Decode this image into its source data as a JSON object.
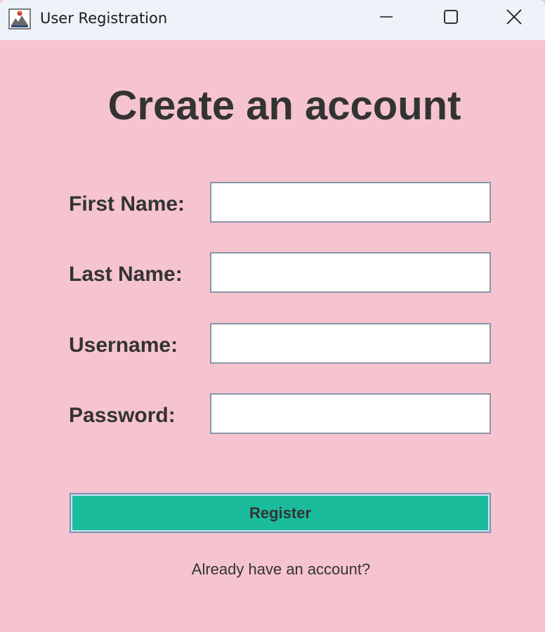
{
  "window": {
    "title": "User Registration",
    "icon": "java-app-icon",
    "controls": {
      "minimize_icon": "minimize-icon",
      "maximize_icon": "maximize-icon",
      "close_icon": "close-icon"
    }
  },
  "form": {
    "heading": "Create an account",
    "fields": [
      {
        "label": "First Name:",
        "value": "",
        "placeholder": ""
      },
      {
        "label": "Last Name:",
        "value": "",
        "placeholder": ""
      },
      {
        "label": "Username:",
        "value": "",
        "placeholder": ""
      },
      {
        "label": "Password:",
        "value": "",
        "placeholder": ""
      }
    ],
    "register_label": "Register",
    "login_link": "Already have an account?"
  },
  "colors": {
    "background": "#f5c4cf",
    "titlebar": "#edf3f8",
    "button": "#1abc9c",
    "text": "#333333"
  }
}
